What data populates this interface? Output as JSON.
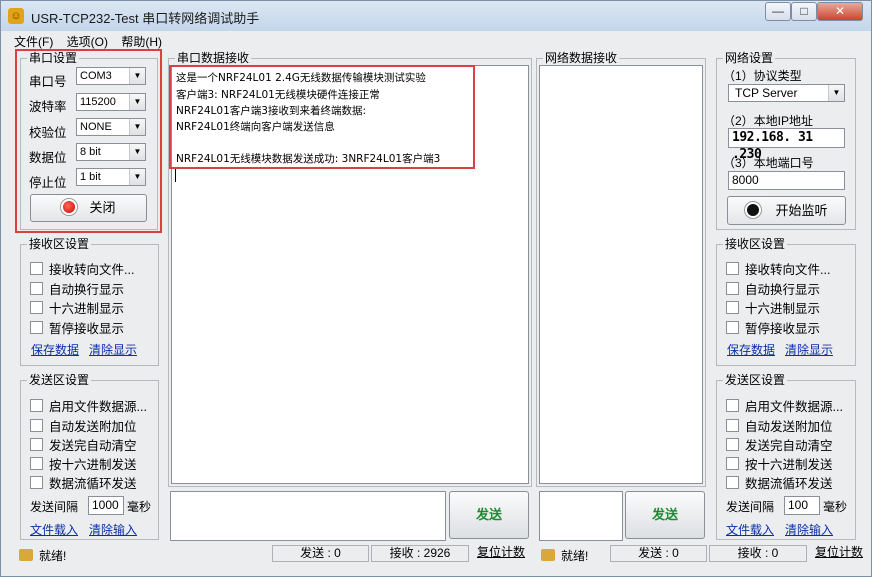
{
  "title": "USR-TCP232-Test 串口转网络调试助手",
  "window_buttons": {
    "minimize": "—",
    "maximize": "□",
    "close": "✕"
  },
  "menu": [
    "文件(F)",
    "选项(O)",
    "帮助(H)"
  ],
  "serial_settings": {
    "legend": "串口设置",
    "rows": [
      {
        "label": "串口号",
        "value": "COM3"
      },
      {
        "label": "波特率",
        "value": "115200"
      },
      {
        "label": "校验位",
        "value": "NONE"
      },
      {
        "label": "数据位",
        "value": "8 bit"
      },
      {
        "label": "停止位",
        "value": "1 bit"
      }
    ],
    "close_button": "关闭"
  },
  "rx_settings_left": {
    "legend": "接收区设置",
    "options": [
      "接收转向文件...",
      "自动换行显示",
      "十六进制显示",
      "暂停接收显示"
    ],
    "save_link": "保存数据",
    "clear_link": "清除显示"
  },
  "tx_settings_left": {
    "legend": "发送区设置",
    "options": [
      "启用文件数据源...",
      "自动发送附加位",
      "发送完自动清空",
      "按十六进制发送",
      "数据流循环发送"
    ],
    "interval_label": "发送间隔",
    "interval_value": "1000",
    "interval_unit": "毫秒",
    "load_link": "文件载入",
    "clear_link": "清除输入"
  },
  "serial_rx": {
    "legend": "串口数据接收",
    "lines": [
      "这是一个NRF24L01 2.4G无线数据传输模块测试实验",
      "客户端3: NRF24L01无线模块硬件连接正常",
      "NRF24L01客户端3接收到来着终端数据:",
      "NRF24L01终端向客户端发送信息",
      "",
      "NRF24L01无线模块数据发送成功: 3NRF24L01客户端3"
    ]
  },
  "net_rx": {
    "legend": "网络数据接收"
  },
  "send_button": "发送",
  "net_settings": {
    "legend": "网络设置",
    "protocol_label": "（1）协议类型",
    "protocol_value": "TCP Server",
    "ip_label": "（2）本地IP地址",
    "ip_value": "192.168. 31 .230",
    "port_label": "（3）本地端口号",
    "port_value": "8000",
    "listen_button": "开始监听"
  },
  "rx_settings_right": {
    "legend": "接收区设置",
    "options": [
      "接收转向文件...",
      "自动换行显示",
      "十六进制显示",
      "暂停接收显示"
    ],
    "save_link": "保存数据",
    "clear_link": "清除显示"
  },
  "tx_settings_right": {
    "legend": "发送区设置",
    "options": [
      "启用文件数据源...",
      "自动发送附加位",
      "发送完自动清空",
      "按十六进制发送",
      "数据流循环发送"
    ],
    "interval_label": "发送间隔",
    "interval_value": "100",
    "interval_unit": "毫秒",
    "load_link": "文件载入",
    "clear_link": "清除输入"
  },
  "status_left": {
    "ready": "就绪!",
    "send": "发送 : 0",
    "recv": "接收 : 2926",
    "reset": "复位计数"
  },
  "status_right": {
    "ready": "就绪!",
    "send": "发送 : 0",
    "recv": "接收 : 0",
    "reset": "复位计数"
  },
  "colors": {
    "highlight_box": "#d9403f",
    "send_text": "#1b8c2e",
    "link": "#0b2fa8"
  }
}
